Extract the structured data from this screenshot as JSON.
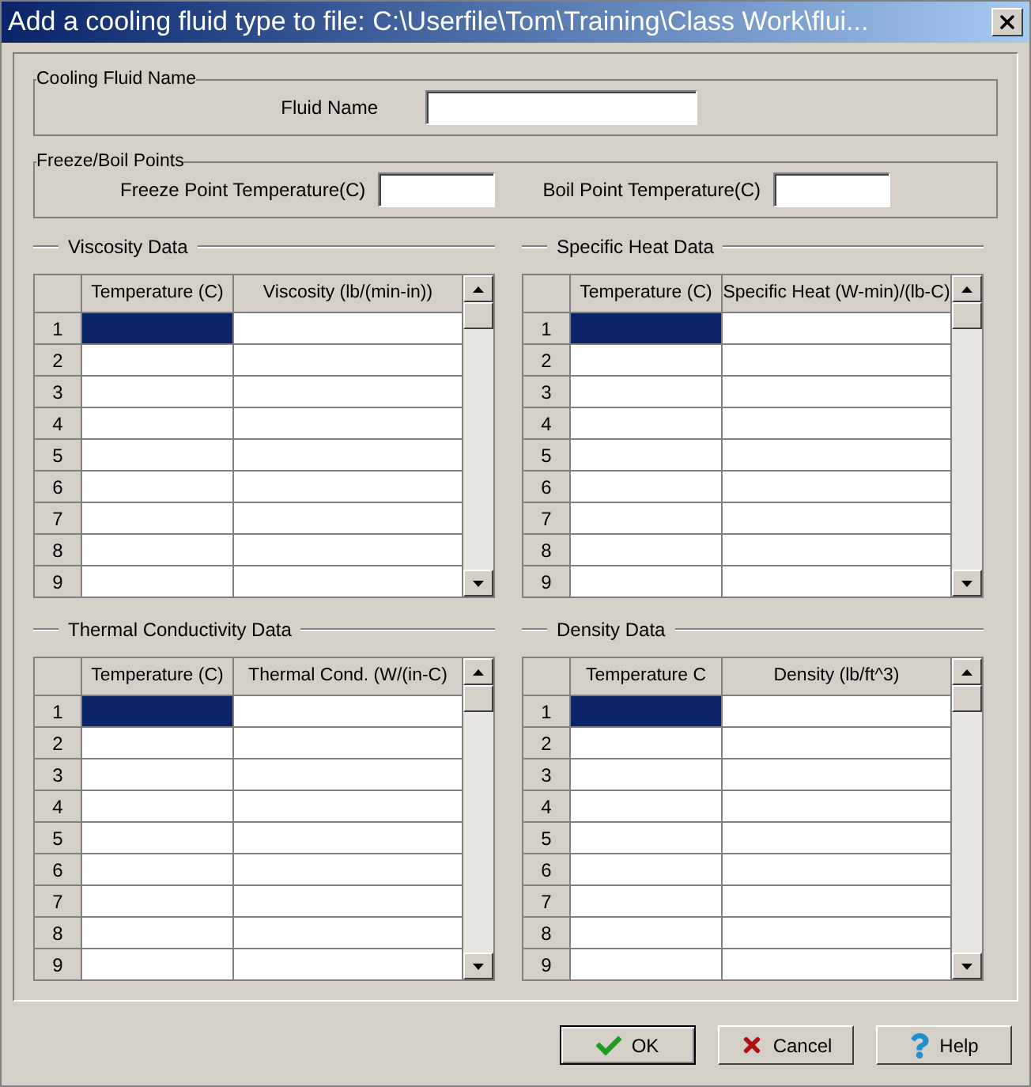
{
  "window": {
    "title": "Add a cooling fluid type to file: C:\\Userfile\\Tom\\Training\\Class Work\\flui..."
  },
  "cooling_fluid_name": {
    "legend": "Cooling Fluid Name",
    "fields": [
      {
        "label": "Fluid Name"
      }
    ]
  },
  "freeze_boil_points": {
    "legend": "Freeze/Boil Points",
    "fields": [
      {
        "label": "Freeze Point Temperature(C)"
      },
      {
        "label": "Boil Point Temperature(C)"
      }
    ]
  },
  "grids": [
    {
      "title": "Viscosity Data",
      "columns": [
        "Temperature (C)",
        "Viscosity (lb/(min-in))"
      ],
      "rows": [
        {
          "label": "1",
          "selected": true
        },
        {
          "label": "2",
          "selected": false
        },
        {
          "label": "3",
          "selected": false
        },
        {
          "label": "4",
          "selected": false
        },
        {
          "label": "5",
          "selected": false
        },
        {
          "label": "6",
          "selected": false
        },
        {
          "label": "7",
          "selected": false
        },
        {
          "label": "8",
          "selected": false
        },
        {
          "label": "9",
          "selected": false
        }
      ]
    },
    {
      "title": "Specific Heat Data",
      "columns": [
        "Temperature (C)",
        "Specific Heat (W-min)/(lb-C)"
      ],
      "rows": [
        {
          "label": "1",
          "selected": true
        },
        {
          "label": "2",
          "selected": false
        },
        {
          "label": "3",
          "selected": false
        },
        {
          "label": "4",
          "selected": false
        },
        {
          "label": "5",
          "selected": false
        },
        {
          "label": "6",
          "selected": false
        },
        {
          "label": "7",
          "selected": false
        },
        {
          "label": "8",
          "selected": false
        },
        {
          "label": "9",
          "selected": false
        }
      ]
    },
    {
      "title": "Thermal Conductivity Data",
      "columns": [
        "Temperature (C)",
        "Thermal Cond. (W/(in-C)"
      ],
      "rows": [
        {
          "label": "1",
          "selected": true
        },
        {
          "label": "2",
          "selected": false
        },
        {
          "label": "3",
          "selected": false
        },
        {
          "label": "4",
          "selected": false
        },
        {
          "label": "5",
          "selected": false
        },
        {
          "label": "6",
          "selected": false
        },
        {
          "label": "7",
          "selected": false
        },
        {
          "label": "8",
          "selected": false
        },
        {
          "label": "9",
          "selected": false
        }
      ]
    },
    {
      "title": "Density Data",
      "columns": [
        "Temperature C",
        "Density (lb/ft^3)"
      ],
      "rows": [
        {
          "label": "1",
          "selected": true
        },
        {
          "label": "2",
          "selected": false
        },
        {
          "label": "3",
          "selected": false
        },
        {
          "label": "4",
          "selected": false
        },
        {
          "label": "5",
          "selected": false
        },
        {
          "label": "6",
          "selected": false
        },
        {
          "label": "7",
          "selected": false
        },
        {
          "label": "8",
          "selected": false
        },
        {
          "label": "9",
          "selected": false
        }
      ]
    }
  ],
  "buttons": [
    {
      "kind": "ok",
      "label": "OK",
      "default": true
    },
    {
      "kind": "cancel",
      "label": "Cancel",
      "default": false
    },
    {
      "kind": "help",
      "label": "Help",
      "default": false
    }
  ]
}
